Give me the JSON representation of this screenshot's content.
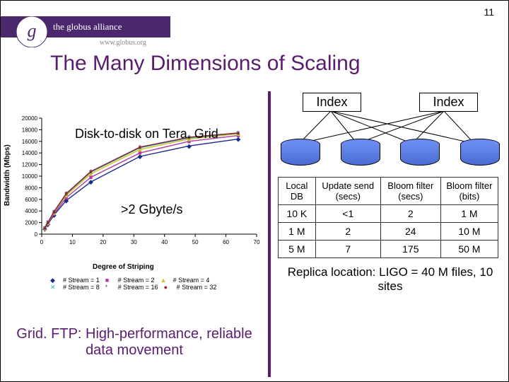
{
  "page_number": "11",
  "logo_text": "the globus alliance",
  "logo_sub": "www.globus.org",
  "title": "The Many Dimensions of Scaling",
  "left": {
    "note1": "Disk-to-disk on Tera. Grid",
    "note2": ">2 Gbyte/s",
    "subtitle": "Grid. FTP: High-performance, reliable data movement"
  },
  "right": {
    "index_label": "Index",
    "table": {
      "headers": [
        "Local DB",
        "Update send (secs)",
        "Bloom filter (secs)",
        "Bloom filter (bits)"
      ],
      "rows": [
        [
          "10 K",
          "<1",
          "2",
          "1 M"
        ],
        [
          "1 M",
          "2",
          "24",
          "10 M"
        ],
        [
          "5 M",
          "7",
          "175",
          "50 M"
        ]
      ]
    },
    "replica_note": "Replica location: LIGO = 40 M files, 10 sites"
  },
  "chart_data": {
    "type": "line",
    "xlabel": "Degree of Striping",
    "ylabel": "Bandwidth (Mbps)",
    "xlim": [
      0,
      70
    ],
    "ylim": [
      0,
      20000
    ],
    "xticks": [
      0,
      10,
      20,
      30,
      40,
      50,
      60,
      70
    ],
    "yticks": [
      0,
      2000,
      4000,
      6000,
      8000,
      10000,
      12000,
      14000,
      16000,
      18000,
      20000
    ],
    "x": [
      1,
      2,
      4,
      8,
      16,
      32,
      48,
      64
    ],
    "series": [
      {
        "name": "# Stream = 1",
        "color": "#1a2a8a",
        "values": [
          900,
          1700,
          3300,
          5800,
          9000,
          13400,
          15200,
          16400
        ]
      },
      {
        "name": "# Stream = 2",
        "color": "#b23aa0",
        "values": [
          950,
          1800,
          3500,
          6300,
          9800,
          14000,
          16000,
          17000
        ]
      },
      {
        "name": "# Stream = 4",
        "color": "#d0c020",
        "values": [
          1000,
          1900,
          3700,
          6700,
          10400,
          14600,
          16400,
          17300
        ]
      },
      {
        "name": "# Stream = 8",
        "color": "#25b0c0",
        "values": [
          1050,
          2000,
          3800,
          6900,
          10700,
          14900,
          16600,
          17400
        ]
      },
      {
        "name": "# Stream = 16",
        "color": "#7a2a8a",
        "values": [
          1050,
          2000,
          3850,
          7000,
          10800,
          15000,
          16700,
          17450
        ]
      },
      {
        "name": "# Stream = 32",
        "color": "#8a2a2a",
        "values": [
          1050,
          2000,
          3850,
          7000,
          10800,
          15000,
          16700,
          17450
        ]
      }
    ]
  }
}
